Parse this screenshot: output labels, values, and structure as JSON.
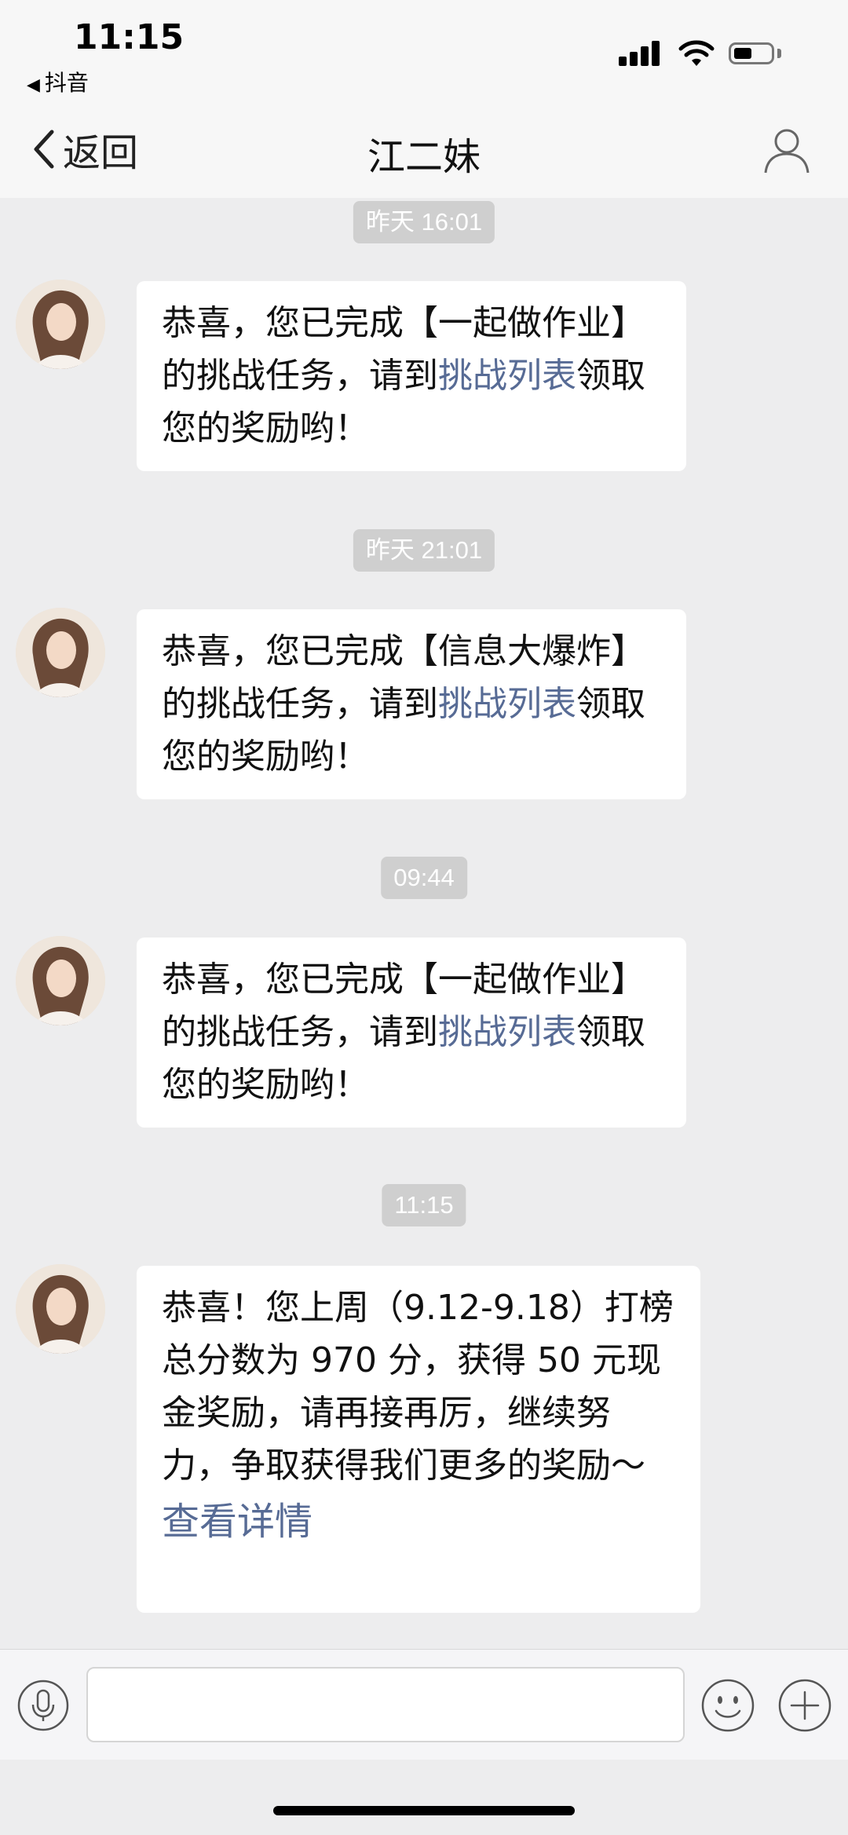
{
  "status": {
    "time": "11:15",
    "back_app": "抖音",
    "back_app_icon": "back-triangle-icon"
  },
  "nav": {
    "back_label": "返回",
    "title": "江二妹",
    "profile_icon": "person-icon"
  },
  "messages": [
    {
      "timestamp": "昨天 16:01",
      "text_before": "恭喜，您已完成【一起做作业】的挑战任务，请到",
      "link": "挑战列表",
      "text_after": "领取您的奖励哟！"
    },
    {
      "timestamp": "昨天 21:01",
      "text_before": "恭喜，您已完成【信息大爆炸】的挑战任务，请到",
      "link": "挑战列表",
      "text_after": "领取您的奖励哟！"
    },
    {
      "timestamp": "09:44",
      "text_before": "恭喜，您已完成【一起做作业】的挑战任务，请到",
      "link": "挑战列表",
      "text_after": "领取您的奖励哟！"
    },
    {
      "timestamp": "11:15",
      "text": "恭喜！您上周（9.12-9.18）打榜总分数为 970 分，获得 50 元现金奖励，请再接再厉，继续努力，争取获得我们更多的奖励～",
      "detail_link": "查看详情"
    }
  ],
  "input_bar": {
    "voice_icon": "microphone-icon",
    "input_value": "",
    "emoji_icon": "smiley-icon",
    "plus_icon": "plus-icon"
  },
  "colors": {
    "link": "#576b95",
    "background": "#ededee",
    "timestamp_bg": "#cfcfcf"
  }
}
